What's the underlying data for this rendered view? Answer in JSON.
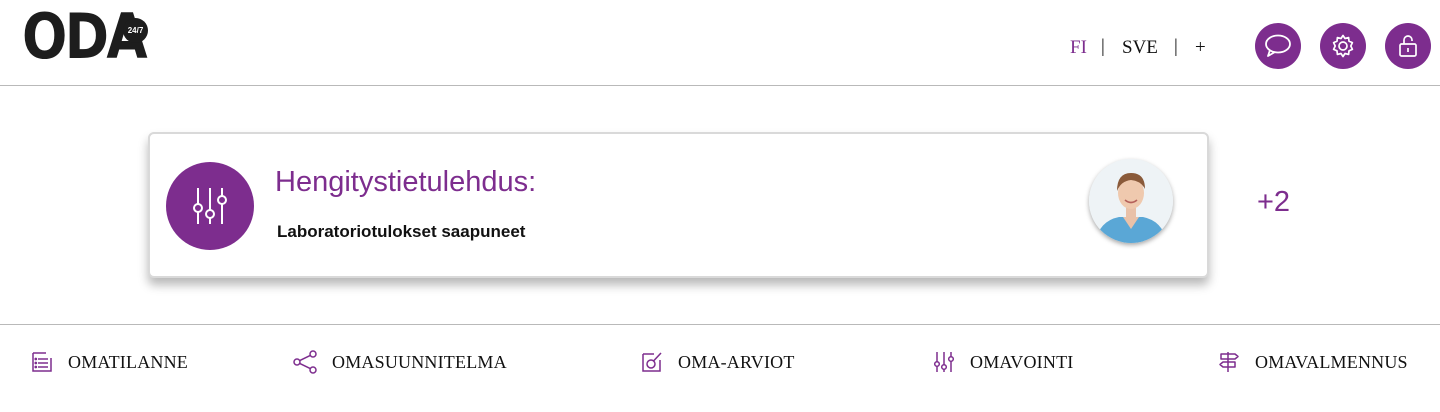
{
  "header": {
    "logo_text": "ODA",
    "logo_badge": "24/7",
    "languages": [
      "FI",
      "SVE",
      "+"
    ],
    "active_language": "FI",
    "buttons": [
      {
        "name": "chat",
        "icon": "chat-bubble-icon"
      },
      {
        "name": "settings",
        "icon": "gear-icon"
      },
      {
        "name": "logout",
        "icon": "unlock-icon"
      }
    ]
  },
  "notification": {
    "title": "Hengitystietulehdus:",
    "subtitle": "Laboratoriotulokset saapuneet",
    "icon": "sliders-icon",
    "more_count": "+2"
  },
  "bottom_nav": {
    "items": [
      {
        "label": "OMATILANNE",
        "icon": "list-document-icon"
      },
      {
        "label": "OMASUUNNITELMA",
        "icon": "share-nodes-icon"
      },
      {
        "label": "OMA-ARVIOT",
        "icon": "check-square-icon"
      },
      {
        "label": "OMAVOINTI",
        "icon": "sliders-icon"
      },
      {
        "label": "OMAVALMENNUS",
        "icon": "signpost-icon"
      }
    ]
  },
  "colors": {
    "accent": "#7d2d8e",
    "text": "#111111",
    "divider": "#b9b9b9"
  }
}
